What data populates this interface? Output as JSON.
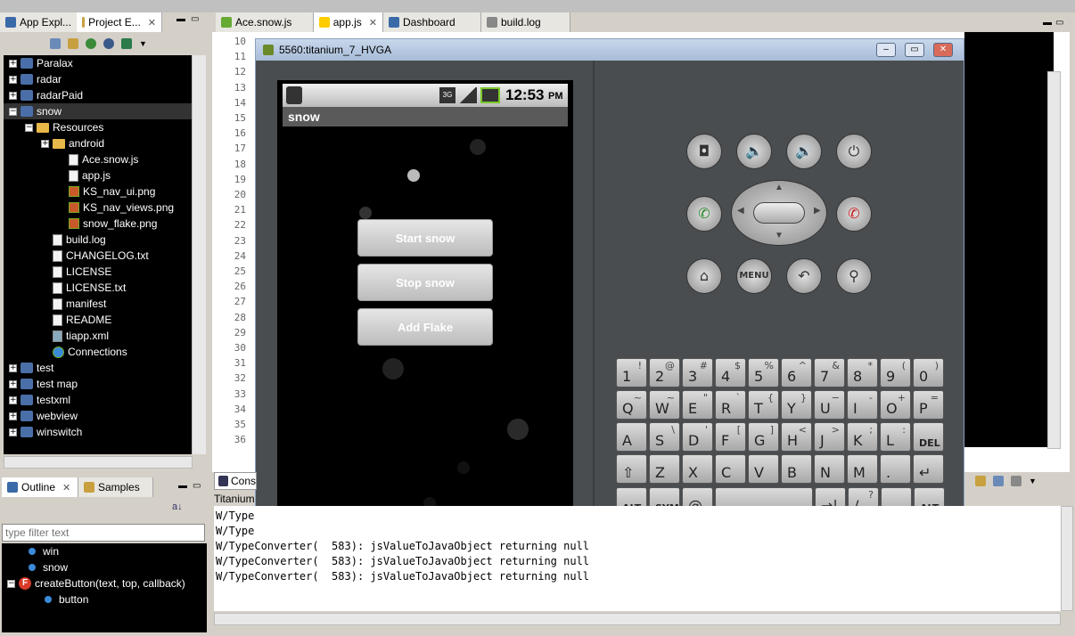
{
  "left_tabs": [
    {
      "label": "App Expl..."
    },
    {
      "label": "Project E..."
    }
  ],
  "editor_tabs": [
    {
      "label": "Ace.snow.js"
    },
    {
      "label": "app.js"
    },
    {
      "label": "Dashboard"
    },
    {
      "label": "build.log"
    }
  ],
  "tree": [
    {
      "label": "Paralax",
      "level": 0,
      "type": "project",
      "expander": "+"
    },
    {
      "label": "radar",
      "level": 0,
      "type": "project",
      "expander": "+"
    },
    {
      "label": "radarPaid",
      "level": 0,
      "type": "project",
      "expander": "+"
    },
    {
      "label": "snow",
      "level": 0,
      "type": "project",
      "expander": "−"
    },
    {
      "label": "Resources",
      "level": 1,
      "type": "folder",
      "expander": "−"
    },
    {
      "label": "android",
      "level": 2,
      "type": "folder",
      "expander": "+"
    },
    {
      "label": "Ace.snow.js",
      "level": 3,
      "type": "file",
      "expander": ""
    },
    {
      "label": "app.js",
      "level": 3,
      "type": "file",
      "expander": ""
    },
    {
      "label": "KS_nav_ui.png",
      "level": 3,
      "type": "image",
      "expander": ""
    },
    {
      "label": "KS_nav_views.png",
      "level": 3,
      "type": "image",
      "expander": ""
    },
    {
      "label": "snow_flake.png",
      "level": 3,
      "type": "image",
      "expander": ""
    },
    {
      "label": "build.log",
      "level": 2,
      "type": "file",
      "expander": ""
    },
    {
      "label": "CHANGELOG.txt",
      "level": 2,
      "type": "file",
      "expander": ""
    },
    {
      "label": "LICENSE",
      "level": 2,
      "type": "file",
      "expander": ""
    },
    {
      "label": "LICENSE.txt",
      "level": 2,
      "type": "file",
      "expander": ""
    },
    {
      "label": "manifest",
      "level": 2,
      "type": "file",
      "expander": ""
    },
    {
      "label": "README",
      "level": 2,
      "type": "file",
      "expander": ""
    },
    {
      "label": "tiapp.xml",
      "level": 2,
      "type": "xml",
      "expander": ""
    },
    {
      "label": "Connections",
      "level": 2,
      "type": "globe",
      "expander": ""
    },
    {
      "label": "test",
      "level": 0,
      "type": "project",
      "expander": "+"
    },
    {
      "label": "test map",
      "level": 0,
      "type": "project",
      "expander": "+"
    },
    {
      "label": "testxml",
      "level": 0,
      "type": "project",
      "expander": "+"
    },
    {
      "label": "webview",
      "level": 0,
      "type": "project",
      "expander": "+"
    },
    {
      "label": "winswitch",
      "level": 0,
      "type": "project",
      "expander": "+"
    }
  ],
  "outline_tabs": [
    {
      "label": "Outline"
    },
    {
      "label": "Samples"
    }
  ],
  "filter_placeholder": "type filter text",
  "outline": [
    {
      "label": "win",
      "level": 1
    },
    {
      "label": "snow",
      "level": 1
    },
    {
      "label": "createButton(text, top, callback)",
      "level": 0
    },
    {
      "label": "button",
      "level": 2
    }
  ],
  "line_numbers": [
    "10",
    "11",
    "12",
    "13",
    "14",
    "15",
    "16",
    "17",
    "18",
    "19",
    "20",
    "21",
    "22",
    "23",
    "24",
    "25",
    "26",
    "27",
    "28",
    "29",
    "30",
    "31",
    "32",
    "33",
    "34",
    "35",
    "36"
  ],
  "emulator": {
    "title": "5560:titanium_7_HVGA",
    "time": "12:53",
    "ampm": "PM",
    "app_title": "snow",
    "buttons": [
      "Start snow",
      "Stop snow",
      "Add Flake"
    ]
  },
  "hard_buttons": [
    "MENU"
  ],
  "keyboard": [
    [
      {
        "m": "1",
        "s": "!"
      },
      {
        "m": "2",
        "s": "@"
      },
      {
        "m": "3",
        "s": "#"
      },
      {
        "m": "4",
        "s": "$"
      },
      {
        "m": "5",
        "s": "%"
      },
      {
        "m": "6",
        "s": "^"
      },
      {
        "m": "7",
        "s": "&"
      },
      {
        "m": "8",
        "s": "*"
      },
      {
        "m": "9",
        "s": "("
      },
      {
        "m": "0",
        "s": ")"
      }
    ],
    [
      {
        "m": "Q",
        "s": "~"
      },
      {
        "m": "W",
        "s": "~"
      },
      {
        "m": "E",
        "s": "\""
      },
      {
        "m": "R",
        "s": "`"
      },
      {
        "m": "T",
        "s": "{"
      },
      {
        "m": "Y",
        "s": "}"
      },
      {
        "m": "U",
        "s": "−"
      },
      {
        "m": "I",
        "s": "-"
      },
      {
        "m": "O",
        "s": "+"
      },
      {
        "m": "P",
        "s": "="
      }
    ],
    [
      {
        "m": "A",
        "s": ""
      },
      {
        "m": "S",
        "s": "\\"
      },
      {
        "m": "D",
        "s": "'"
      },
      {
        "m": "F",
        "s": "["
      },
      {
        "m": "G",
        "s": "]"
      },
      {
        "m": "H",
        "s": "<"
      },
      {
        "m": "J",
        "s": ">"
      },
      {
        "m": "K",
        "s": ";"
      },
      {
        "m": "L",
        "s": ":"
      },
      {
        "m": "DEL",
        "s": ""
      }
    ],
    [
      {
        "m": "⇧",
        "s": ""
      },
      {
        "m": "Z",
        "s": ""
      },
      {
        "m": "X",
        "s": ""
      },
      {
        "m": "C",
        "s": ""
      },
      {
        "m": "V",
        "s": ""
      },
      {
        "m": "B",
        "s": ""
      },
      {
        "m": "N",
        "s": ""
      },
      {
        "m": "M",
        "s": ""
      },
      {
        "m": ".",
        "s": ""
      },
      {
        "m": "↵",
        "s": ""
      }
    ],
    [
      {
        "m": "ALT",
        "s": ""
      },
      {
        "m": "SYM",
        "s": ""
      },
      {
        "m": "@",
        "s": ""
      },
      {
        "m": "",
        "s": ""
      },
      {
        "m": "→|",
        "s": ""
      },
      {
        "m": "/",
        "s": "?"
      },
      {
        "m": ",",
        "s": ""
      },
      {
        "m": "ALT",
        "s": ""
      }
    ]
  ],
  "console": {
    "tab": "Cons",
    "header": "Titanium",
    "lines": [
      "W/Type",
      "W/Type",
      "W/TypeConverter(  583): jsValueToJavaObject returning null",
      "W/TypeConverter(  583): jsValueToJavaObject returning null",
      "W/TypeConverter(  583): jsValueToJavaObject returning null"
    ]
  },
  "window_buttons": [
    "–",
    "▭",
    "✕"
  ],
  "colors": {
    "call": "#2a8a2a",
    "endcall": "#c82020",
    "tree_bg": "#000000"
  }
}
